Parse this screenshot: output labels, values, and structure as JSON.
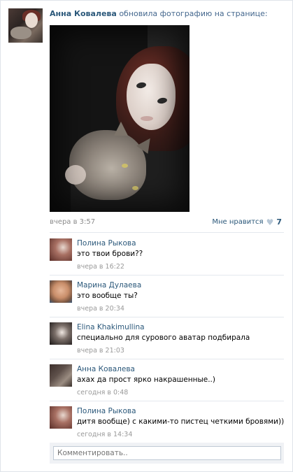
{
  "post": {
    "author": "Анна Ковалева",
    "action": "обновила фотографию на странице:",
    "time": "вчера в 3:57",
    "like_label": "Мне нравится",
    "like_count": "7"
  },
  "comments": [
    {
      "name": "Полина Рыкова",
      "text": "это твои брови??",
      "time": "вчера в 16:22"
    },
    {
      "name": "Марина Дулаева",
      "text": "это вообще ты?",
      "time": "вчера в 20:34"
    },
    {
      "name": "Elina Khakimullina",
      "text": "специально для сурового аватар подбирала",
      "time": "вчера в 21:03"
    },
    {
      "name": "Анна Ковалева",
      "text": "ахах да прост ярко накрашенные..)",
      "time": "сегодня в 0:48"
    },
    {
      "name": "Полина Рыкова",
      "text": "дитя вообще) с какими-то пистец четкими бровями))",
      "time": "сегодня в 14:34"
    }
  ],
  "reply": {
    "placeholder": "Комментировать.."
  },
  "icons": {
    "like": "heart-icon"
  }
}
